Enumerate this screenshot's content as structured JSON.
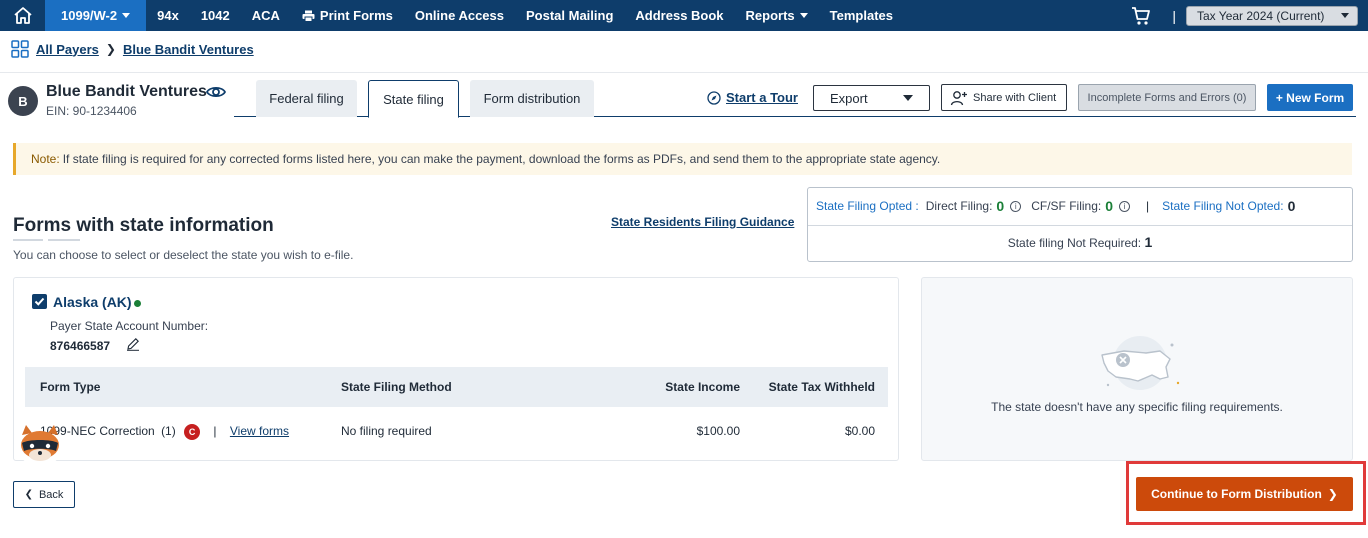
{
  "topnav": {
    "items": [
      {
        "label": "1099/W-2",
        "active": true,
        "dropdown": true
      },
      {
        "label": "94x"
      },
      {
        "label": "1042"
      },
      {
        "label": "ACA"
      },
      {
        "label": "Print Forms",
        "icon": "printer-icon"
      },
      {
        "label": "Online Access"
      },
      {
        "label": "Postal Mailing"
      },
      {
        "label": "Address Book"
      },
      {
        "label": "Reports",
        "dropdown": true
      },
      {
        "label": "Templates"
      }
    ],
    "separator": "|",
    "tax_year": "Tax Year 2024 (Current)"
  },
  "breadcrumb": {
    "root": "All Payers",
    "current": "Blue Bandit Ventures"
  },
  "payer": {
    "initial": "B",
    "name": "Blue Bandit Ventures",
    "ein": "EIN: 90-1234406"
  },
  "tabs": [
    {
      "label": "Federal filing"
    },
    {
      "label": "State filing",
      "active": true
    },
    {
      "label": "Form distribution"
    }
  ],
  "toolbar": {
    "tour": "Start a Tour",
    "export": "Export",
    "share": "Share with Client",
    "incomplete": "Incomplete Forms and Errors (0)",
    "new_form": "+ New Form"
  },
  "note": {
    "label": "Note:",
    "text": "If state filing is required for any corrected forms listed here, you can make the payment, download the forms as PDFs, and send them to the appropriate state agency."
  },
  "section": {
    "title": "Forms with state information",
    "subtitle": "You can choose to select or deselect the state you wish to e-file.",
    "guidance_link": "State Residents Filing Guidance"
  },
  "stats": {
    "opted_label": "State Filing Opted :",
    "direct_label": "Direct Filing:",
    "direct_value": "0",
    "cfsf_label": "CF/SF Filing:",
    "cfsf_value": "0",
    "sep": "|",
    "not_opted_label": "State Filing Not Opted:",
    "not_opted_value": "0",
    "not_required_label": "State filing Not Required:",
    "not_required_value": "1"
  },
  "state_card": {
    "state": "Alaska (AK)",
    "account_label": "Payer State Account Number:",
    "account_number": "876466587",
    "columns": [
      "Form Type",
      "State Filing Method",
      "State Income",
      "State Tax Withheld"
    ],
    "rows": [
      {
        "form_type": "1099-NEC Correction",
        "count": "(1)",
        "badge": "C",
        "sep": "|",
        "view": "View forms",
        "method": "No filing required",
        "income": "$100.00",
        "withheld": "$0.00"
      }
    ]
  },
  "empty_state": {
    "text": "The state doesn't have any specific filing requirements."
  },
  "footer": {
    "back": "Back",
    "continue": "Continue to Form Distribution"
  },
  "colors": {
    "nav": "#0e3d6b",
    "active_nav": "#1b6fc2",
    "continue": "#cc4a0b",
    "highlight": "#e03a3a",
    "note_bg": "#fdf7e8"
  }
}
